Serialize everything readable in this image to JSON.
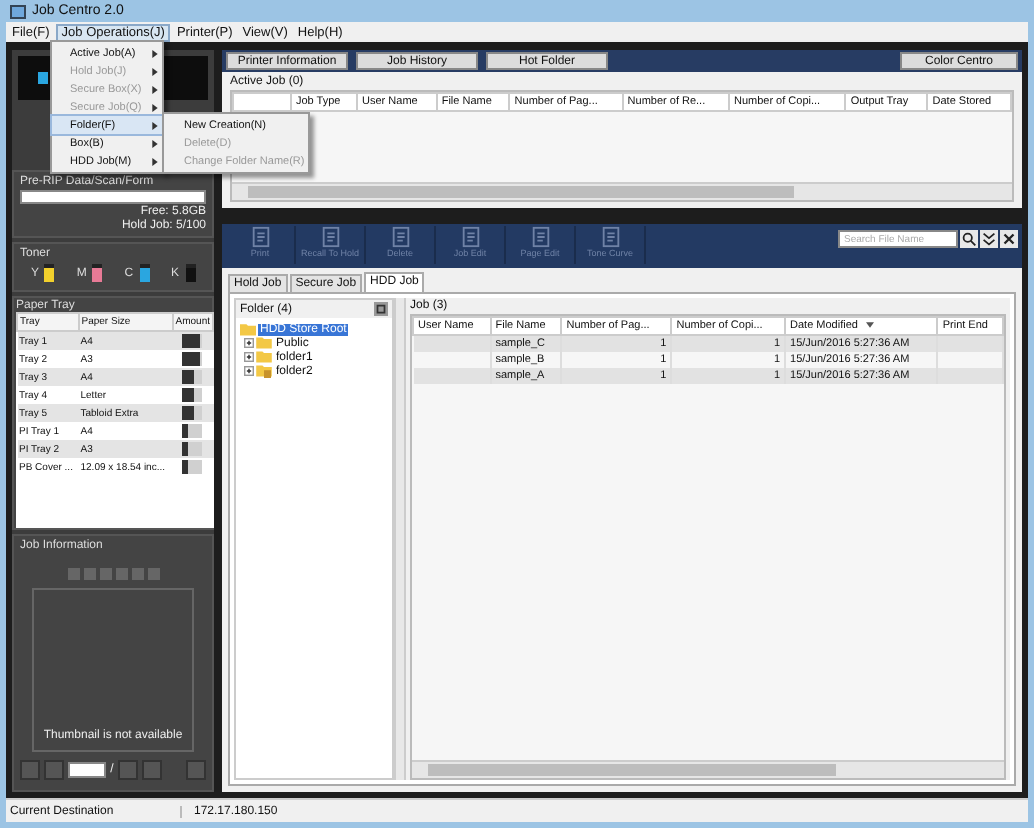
{
  "window": {
    "title": "Job Centro 2.0"
  },
  "menu_bar": [
    {
      "label": "File(F)",
      "selected": false
    },
    {
      "label": "Job Operations(J)",
      "selected": true
    },
    {
      "label": "Printer(P)",
      "selected": false
    },
    {
      "label": "View(V)",
      "selected": false
    },
    {
      "label": "Help(H)",
      "selected": false
    }
  ],
  "open_menu": [
    {
      "label": "Active Job(A)",
      "disabled": false,
      "selected": false
    },
    {
      "label": "Hold Job(J)",
      "disabled": true,
      "selected": false
    },
    {
      "label": "Secure Box(X)",
      "disabled": true,
      "selected": false
    },
    {
      "label": "Secure Job(Q)",
      "disabled": true,
      "selected": false
    },
    {
      "label": "Folder(F)",
      "disabled": false,
      "selected": true
    },
    {
      "label": "Box(B)",
      "disabled": false,
      "selected": false
    },
    {
      "label": "HDD Job(M)",
      "disabled": false,
      "selected": false
    }
  ],
  "submenu": [
    {
      "label": "New Creation(N)",
      "disabled": false
    },
    {
      "label": "Delete(D)",
      "disabled": true
    },
    {
      "label": "Change Folder Name(R)",
      "disabled": true
    }
  ],
  "storage": {
    "label": "Pre-RIP Data/Scan/Form",
    "free": "Free: 5.8GB",
    "hold": "Hold Job: 5/100"
  },
  "toner": {
    "title": "Toner",
    "items": [
      {
        "label": "Y",
        "color": "#f2d02c",
        "level": 0.8
      },
      {
        "label": "M",
        "color": "#e87a96",
        "level": 0.8
      },
      {
        "label": "C",
        "color": "#2aa6e0",
        "level": 0.8
      },
      {
        "label": "K",
        "color": "#111111",
        "level": 0.8
      }
    ]
  },
  "paper_tray": {
    "title": "Paper Tray",
    "columns": [
      "Tray",
      "Paper Size",
      "Amount"
    ],
    "rows": [
      {
        "tray": "Tray 1",
        "size": "A4",
        "level": 0.9
      },
      {
        "tray": "Tray 2",
        "size": "A3",
        "level": 0.9
      },
      {
        "tray": "Tray 3",
        "size": "A4",
        "level": 0.6
      },
      {
        "tray": "Tray 4",
        "size": "Letter",
        "level": 0.6
      },
      {
        "tray": "Tray 5",
        "size": "Tabloid Extra",
        "level": 0.6
      },
      {
        "tray": "PI Tray 1",
        "size": "A4",
        "level": 0.3
      },
      {
        "tray": "PI Tray 2",
        "size": "A3",
        "level": 0.3
      },
      {
        "tray": "PB Cover ...",
        "size": "12.09 x 18.54 inc...",
        "level": 0.3
      }
    ]
  },
  "job_information": {
    "title": "Job Information",
    "thumbnail": "Thumbnail is not available",
    "separator": "/"
  },
  "nav_buttons": [
    "Printer Information",
    "Job History",
    "Hot Folder"
  ],
  "color_button": "Color Centro",
  "active_job": {
    "title": "Active Job (0)",
    "columns": [
      "Job Type",
      "User Name",
      "File Name",
      "Number of Pag...",
      "Number of  Re...",
      "Number of Copi...",
      "Output Tray",
      "Date Stored"
    ]
  },
  "toolbar": [
    {
      "label": "Print",
      "disabled": true
    },
    {
      "label": "Recall To Hold",
      "disabled": true
    },
    {
      "label": "Delete",
      "disabled": true
    },
    {
      "label": "Job Edit",
      "disabled": true
    },
    {
      "label": "Page Edit",
      "disabled": true
    },
    {
      "label": "Tone Curve",
      "disabled": true
    }
  ],
  "search": {
    "placeholder": "Search File Name"
  },
  "tabs": [
    {
      "label": "Hold Job",
      "selected": false
    },
    {
      "label": "Secure Job",
      "selected": false
    },
    {
      "label": "HDD Job",
      "selected": true
    }
  ],
  "folder_pane": {
    "title": "Folder (4)",
    "tree": [
      {
        "label": "HDD Store Root",
        "selected": true,
        "children": [
          {
            "label": "Public",
            "selected": false,
            "locked": false
          },
          {
            "label": "folder1",
            "selected": false,
            "locked": false
          },
          {
            "label": "folder2",
            "selected": false,
            "locked": true
          }
        ]
      }
    ]
  },
  "job_pane": {
    "title": "Job (3)",
    "columns": [
      "User Name",
      "File Name",
      "Number of Pag...",
      "Number of Copi...",
      "Date Modified",
      "Print End"
    ],
    "rows": [
      {
        "file_name": "sample_C",
        "pages": "1",
        "copies": "1",
        "date_modified": "15/Jun/2016 5:27:36 AM"
      },
      {
        "file_name": "sample_B",
        "pages": "1",
        "copies": "1",
        "date_modified": "15/Jun/2016 5:27:36 AM"
      },
      {
        "file_name": "sample_A",
        "pages": "1",
        "copies": "1",
        "date_modified": "15/Jun/2016 5:27:36 AM"
      }
    ]
  },
  "status_bar": [
    "Current Destination",
    "172.17.180.150"
  ]
}
